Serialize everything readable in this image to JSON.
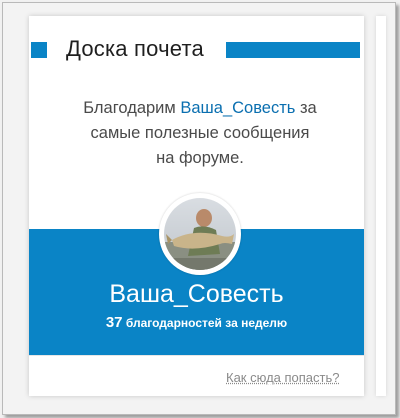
{
  "widget": {
    "title": "Доска почета",
    "thanks_prefix": "Благодарим",
    "username": "Ваша_Совесть",
    "thanks_suffix_1": "за",
    "thanks_line_2": "самые полезные сообщения",
    "thanks_line_3": "на форуме.",
    "display_name": "Ваша_Совесть",
    "thanks_count": "37",
    "thanks_count_label": "благодарностей за неделю",
    "how_link": "Как сюда попасть?"
  },
  "colors": {
    "accent": "#0a84c6",
    "username_link": "#0a6fb0",
    "body_text": "#4a4a4a"
  },
  "icons": {
    "avatar": "user-avatar-photo"
  }
}
